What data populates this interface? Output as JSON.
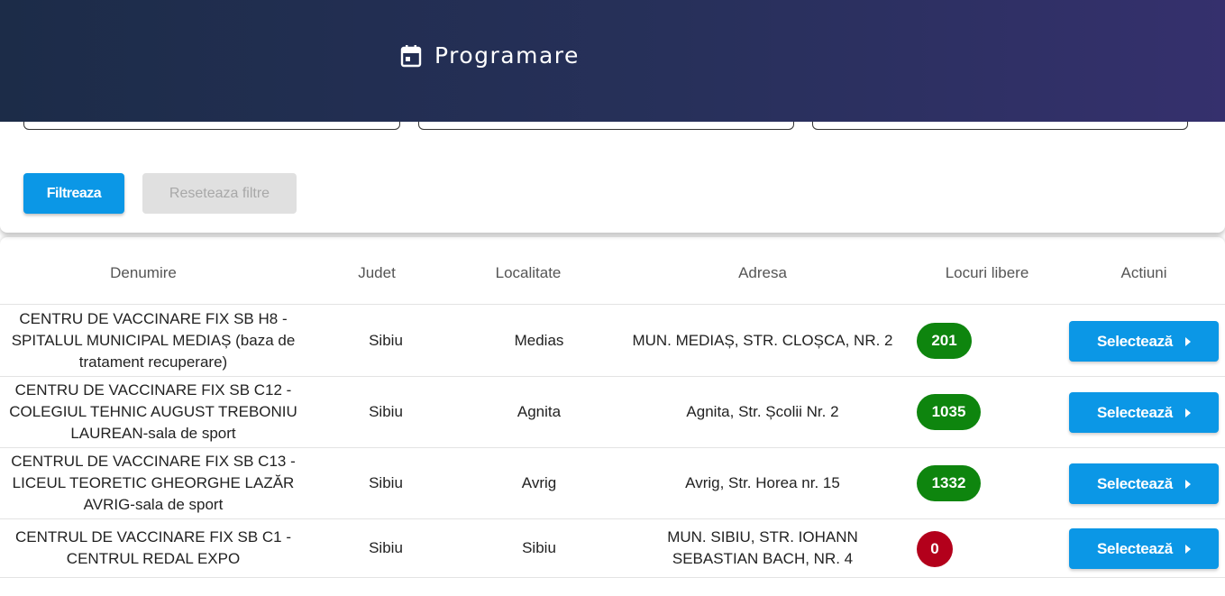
{
  "header": {
    "title": "Programare",
    "icon": "calendar-icon"
  },
  "filters": {
    "filter_label": "Filtreaza",
    "reset_label": "Reseteaza filtre"
  },
  "table": {
    "columns": [
      "Denumire",
      "Judet",
      "Localitate",
      "Adresa",
      "Locuri libere",
      "Actiuni"
    ],
    "rows": [
      {
        "name": "CENTRU DE VACCINARE FIX SB H8 - SPITALUL MUNICIPAL MEDIAȘ (baza de tratament recuperare)",
        "judet": "Sibiu",
        "localitate": "Medias",
        "adresa": "MUN. MEDIAȘ, STR. CLOȘCA, NR. 2",
        "locuri": "201",
        "status_color": "#0e850e",
        "action": "Selectează"
      },
      {
        "name": "CENTRU DE VACCINARE FIX SB C12 - COLEGIUL TEHNIC AUGUST TREBONIU LAUREAN-sala de sport",
        "judet": "Sibiu",
        "localitate": "Agnita",
        "adresa": "Agnita, Str. Școlii Nr. 2",
        "locuri": "1035",
        "status_color": "#0e850e",
        "action": "Selectează"
      },
      {
        "name": "CENTRUL DE VACCINARE FIX SB C13 - LICEUL TEORETIC GHEORGHE LAZĂR AVRIG-sala de sport",
        "judet": "Sibiu",
        "localitate": "Avrig",
        "adresa": "Avrig, Str. Horea nr. 15",
        "locuri": "1332",
        "status_color": "#0e850e",
        "action": "Selectează"
      },
      {
        "name": "CENTRUL DE VACCINARE FIX SB C1 - CENTRUL REDAL EXPO",
        "judet": "Sibiu",
        "localitate": "Sibiu",
        "adresa": "MUN. SIBIU, STR. IOHANN SEBASTIAN BACH, NR. 4",
        "locuri": "0",
        "status_color": "#b3001b",
        "action": "Selectează"
      }
    ]
  },
  "colors": {
    "primary": "#0b97e6",
    "available": "#0e850e",
    "unavailable": "#b3001b"
  }
}
